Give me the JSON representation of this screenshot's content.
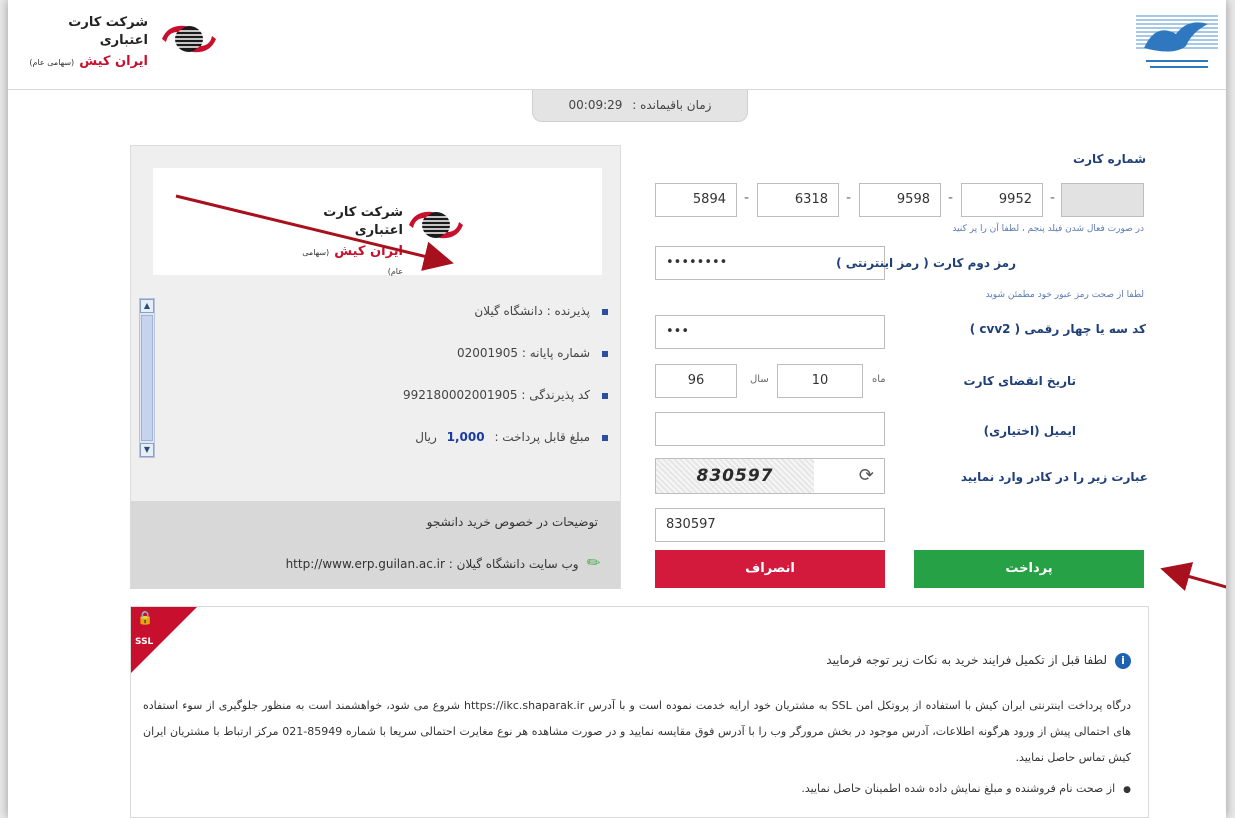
{
  "header": {
    "company_name": "شرکت کارت اعتباری",
    "company_sub": "ایران کیش",
    "company_sub_small": "(سهامی عام)"
  },
  "timer": {
    "label": "زمان باقیمانده :",
    "value": "00:09:29"
  },
  "merchant": {
    "company_name": "شرکت کارت اعتباری",
    "company_sub": "ایران کیش",
    "company_sub_small": "(سهامی عام)",
    "acceptor": "پذیرنده : دانشگاه گیلان",
    "terminal": "شماره پایانه : 02001905",
    "acceptor_code": "کد پذیرندگی : 992180002001905",
    "amount_label": "مبلغ قابل پرداخت :",
    "amount_value": "1,000",
    "amount_unit": "ریال",
    "description": "توضیحات در خصوص خرید دانشجو",
    "website": "وب سایت دانشگاه گیلان : http://www.erp.guilan.ac.ir"
  },
  "form": {
    "card_number_label": "شماره کارت",
    "card_parts": [
      "5894",
      "6318",
      "9598",
      "9952",
      ""
    ],
    "card_hint": "در صورت فعال شدن فیلد پنجم ، لطفا آن را پر کنید",
    "pin2_label": "رمز دوم کارت ( رمز اینترنتی )",
    "pin2_value": "••••••••",
    "pin2_hint": "لطفا از صحت رمز عبور خود مطمئن شوید",
    "cvv2_label": "کد سه یا چهار رقمی ( cvv2 )",
    "cvv2_value": "•••",
    "expiry_label": "تاریخ انقضای کارت",
    "month_label": "ماه",
    "month_value": "10",
    "year_label": "سال",
    "year_value": "96",
    "email_label": "ایمیل (اختیاری)",
    "email_value": "",
    "captcha_label": "عبارت زیر را در کادر وارد نمایید",
    "captcha_text": "830597",
    "captcha_value": "830597",
    "pay_button": "پرداخت",
    "cancel_button": "انصراف"
  },
  "notice": {
    "ssl_label": "SSL",
    "title": "لطفا قبل از تکمیل فرایند خرید به نکات زیر توجه فرمایید",
    "body": "درگاه پرداخت اینترنتی ایران کیش با استفاده از پروتکل امن SSL به مشتریان خود ارایه خدمت نموده است و با آدرس https://ikc.shaparak.ir شروع می شود، خواهشمند است به منظور جلوگیری از سوء استفاده های احتمالی پیش از ورود هرگونه اطلاعات، آدرس موجود در بخش مرورگر وب را با آدرس فوق مقایسه نمایید و در صورت مشاهده هر نوع مغایرت احتمالی سریعا با شماره 85949-021 مرکز ارتباط با مشتریان ایران کیش تماس حاصل نمایید.",
    "bullet_1": "از صحت نام فروشنده و مبلغ نمایش داده شده اطمینان حاصل نمایید."
  },
  "colors": {
    "pay": "#27a146",
    "cancel": "#d41a3c",
    "brand_red": "#c8102e",
    "label_blue": "#1f3f7a"
  }
}
